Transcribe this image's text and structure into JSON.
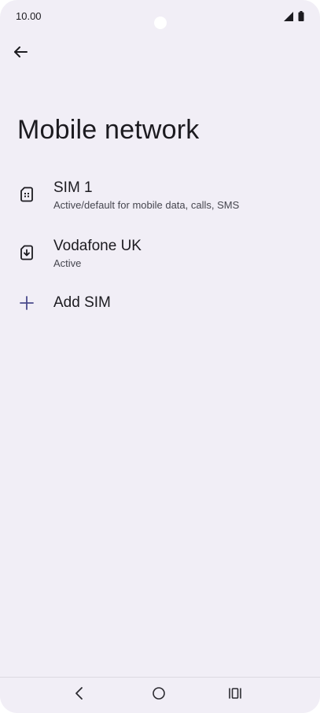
{
  "status_bar": {
    "time": "10.00",
    "icons": [
      "signal-icon",
      "battery-icon"
    ]
  },
  "header": {
    "back_icon": "arrow-left-icon",
    "title": "Mobile network"
  },
  "list": {
    "items": [
      {
        "icon": "sim-card-icon",
        "title": "SIM 1",
        "subtitle": "Active/default for mobile data, calls, SMS"
      },
      {
        "icon": "esim-download-icon",
        "title": "Vodafone UK",
        "subtitle": "Active"
      },
      {
        "icon": "plus-icon",
        "title": "Add SIM"
      }
    ]
  },
  "nav_bar": {
    "icons": [
      "back-icon",
      "home-icon",
      "recents-icon"
    ]
  },
  "colors": {
    "background": "#f1eef6",
    "text": "#1c1b20",
    "secondary_text": "#46464f",
    "accent": "#4a4a8c"
  }
}
